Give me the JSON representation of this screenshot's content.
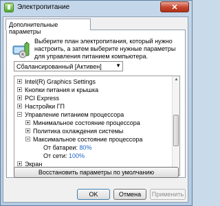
{
  "window": {
    "title": "Электропитание",
    "close_symbol": "✕"
  },
  "tab": {
    "label": "Дополнительные параметры"
  },
  "description": "Выберите план электропитания, который нужно настроить, а затем выберите нужные параметры для управления питанием компьютера.",
  "plan_select": {
    "value": "Сбалансированный [Активен]",
    "arrow": "▼"
  },
  "tree": {
    "rows": [
      {
        "label": "Intel(R) Graphics Settings",
        "expander": "plus"
      },
      {
        "label": "Кнопки питания и крышка",
        "expander": "plus"
      },
      {
        "label": "PCI Express",
        "expander": "plus"
      },
      {
        "label": "Настройки ГП",
        "expander": "plus"
      },
      {
        "label": "Управление питанием процессора",
        "expander": "minus"
      },
      {
        "label": "Минимальное состояние процессора",
        "expander": "plus"
      },
      {
        "label": "Политика охлаждения системы",
        "expander": "plus"
      },
      {
        "label": "Максимальное состояние процессора",
        "expander": "minus"
      },
      {
        "label": "От батареи:",
        "value": "80%"
      },
      {
        "label": "От сети:",
        "value": "100%"
      },
      {
        "label": "Экран",
        "expander": "plus"
      }
    ]
  },
  "scrollbar": {
    "up": "▲",
    "down": "▼"
  },
  "buttons": {
    "restore": "Восстановить параметры по умолчанию",
    "ok": "OK",
    "cancel": "Отмена",
    "apply": "Применить"
  },
  "colors": {
    "value_text": "#1a64c4",
    "close_button": "#c5452c"
  }
}
